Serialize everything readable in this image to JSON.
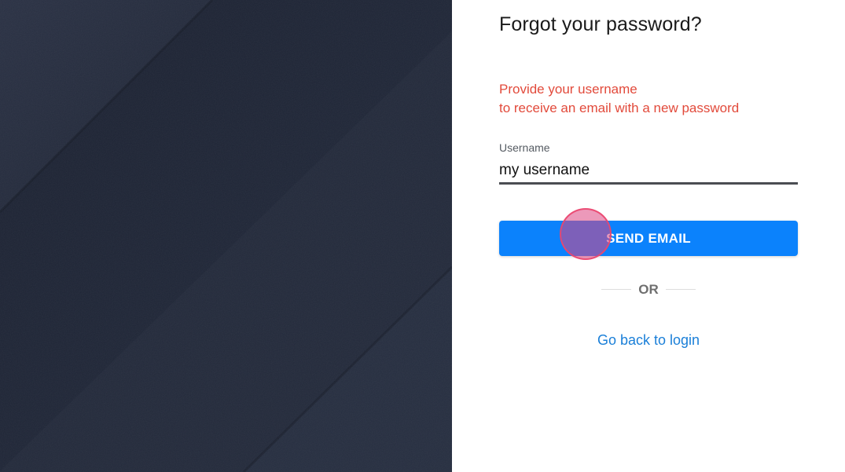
{
  "form": {
    "title": "Forgot your password?",
    "instruction_line1": "Provide your username",
    "instruction_line2": "to receive an email with a new password",
    "username_label": "Username",
    "username_value": "my username",
    "send_button_label": "SEND EMAIL",
    "divider_text": "OR",
    "back_link_label": "Go back to login"
  },
  "colors": {
    "accent": "#0b82fc",
    "instruction_text": "#e24a3b",
    "link": "#1a7fd8",
    "background_panel": "#232a3b"
  },
  "icons": {
    "click_indicator": "click-indicator"
  }
}
